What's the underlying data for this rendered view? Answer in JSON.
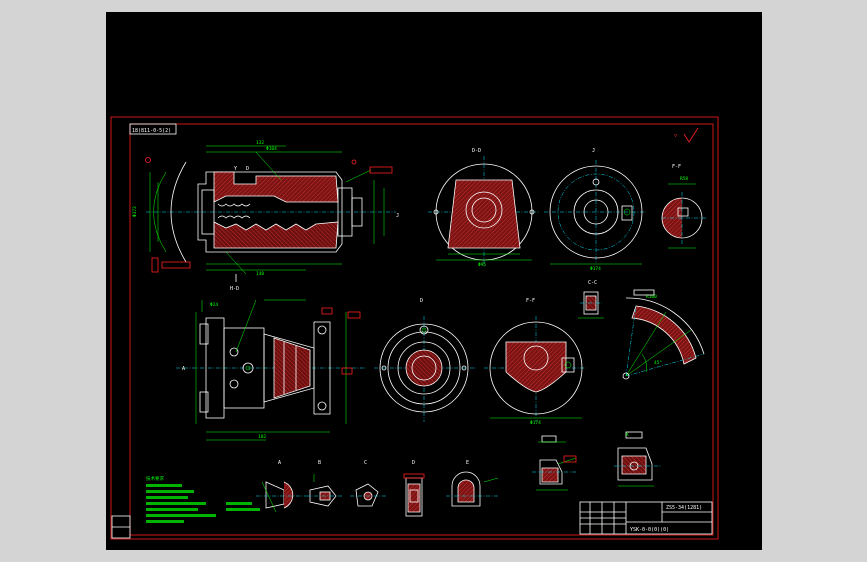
{
  "drawing": {
    "title_block_code": "ZS5-34(1281)",
    "title_block_name": "YSK-0-0(0)(0)",
    "drawing_number_tag": "18(811-0-5(2)",
    "view_labels": {
      "top_section": "D-D",
      "top_right_view": "J",
      "far_right_section": "F-F",
      "mid_left_section": "H-D",
      "mid_center_view": "D",
      "mid_right_section": "F-F",
      "small_section": "C-C",
      "detail_a": "A",
      "detail_b": "B",
      "detail_c": "C",
      "detail_d": "D",
      "detail_e": "E"
    },
    "notes_heading": "技术要求"
  },
  "colors": {
    "background": "#000000",
    "frame": "#ff2020",
    "outline": "#ffffff",
    "dimension": "#00ff00",
    "centerline": "#00e5ff",
    "section_fill": "#7a1414"
  }
}
